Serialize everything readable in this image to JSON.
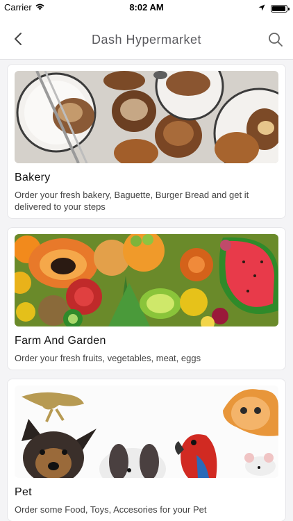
{
  "status_bar": {
    "carrier": "Carrier",
    "time": "8:02 AM",
    "icons": [
      "wifi-icon",
      "location-arrow-icon",
      "battery-icon"
    ],
    "battery_level_percent": 95
  },
  "nav": {
    "title": "Dash Hypermarket",
    "back_icon": "chevron-left-icon",
    "search_icon": "search-icon"
  },
  "categories": [
    {
      "title": "Bakery",
      "description": "Order your fresh bakery, Baguette, Burger Bread and get it delivered to your steps"
    },
    {
      "title": "Farm And Garden",
      "description": "Order your fresh fruits, vegetables, meat, eggs"
    },
    {
      "title": "Pet",
      "description": "Order some Food, Toys, Accesories for your Pet"
    }
  ],
  "colors": {
    "background": "#f4f4f6",
    "card": "#ffffff",
    "title_text": "#5a5a5e"
  }
}
